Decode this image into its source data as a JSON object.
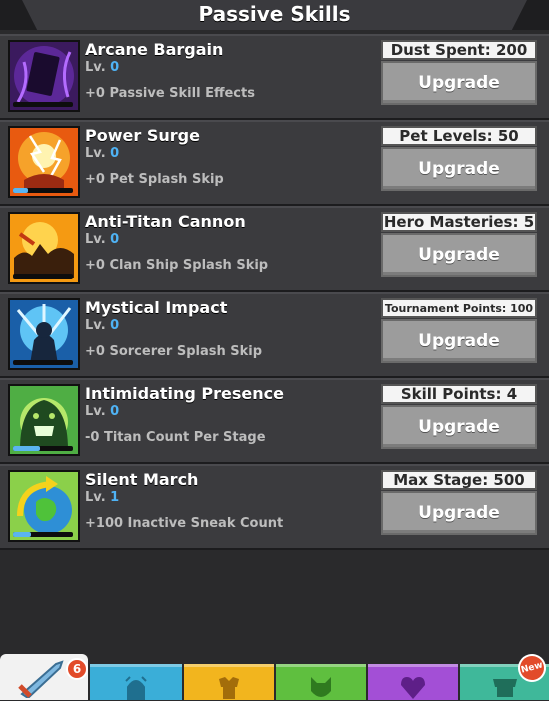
{
  "header": {
    "title": "Passive Skills"
  },
  "skills": [
    {
      "name": "Arcane Bargain",
      "lv_label": "Lv.",
      "lv": "0",
      "effect": "+0 Passive Skill Effects",
      "requirement": "Dust Spent: 200",
      "button": "Upgrade",
      "progress": 0.0
    },
    {
      "name": "Power Surge",
      "lv_label": "Lv.",
      "lv": "0",
      "effect": "+0 Pet Splash Skip",
      "requirement": "Pet Levels: 50",
      "button": "Upgrade",
      "progress": 0.25
    },
    {
      "name": "Anti-Titan Cannon",
      "lv_label": "Lv.",
      "lv": "0",
      "effect": "+0 Clan Ship Splash Skip",
      "requirement": "Hero Masteries: 5",
      "button": "Upgrade",
      "progress": 0.0
    },
    {
      "name": "Mystical Impact",
      "lv_label": "Lv.",
      "lv": "0",
      "effect": "+0 Sorcerer Splash Skip",
      "requirement": "Tournament Points: 100",
      "button": "Upgrade",
      "progress": 0.0
    },
    {
      "name": "Intimidating Presence",
      "lv_label": "Lv.",
      "lv": "0",
      "effect": "-0 Titan Count Per Stage",
      "requirement": "Skill Points: 4",
      "button": "Upgrade",
      "progress": 0.45
    },
    {
      "name": "Silent March",
      "lv_label": "Lv.",
      "lv": "1",
      "effect": "+100 Inactive Sneak Count",
      "requirement": "Max Stage: 500",
      "button": "Upgrade",
      "progress": 0.3
    }
  ],
  "bottom_tabs": {
    "sword_badge": "6",
    "new_badge": "New",
    "tabs": [
      {
        "icon": "sword-icon",
        "color": "#f2f2f2"
      },
      {
        "icon": "hero-icon",
        "color": "#3aaed8"
      },
      {
        "icon": "armor-icon",
        "color": "#f2b51e"
      },
      {
        "icon": "pet-icon",
        "color": "#5fbf3f"
      },
      {
        "icon": "clan-icon",
        "color": "#a34fd6"
      },
      {
        "icon": "shop-icon",
        "color": "#3fb89a"
      }
    ]
  }
}
